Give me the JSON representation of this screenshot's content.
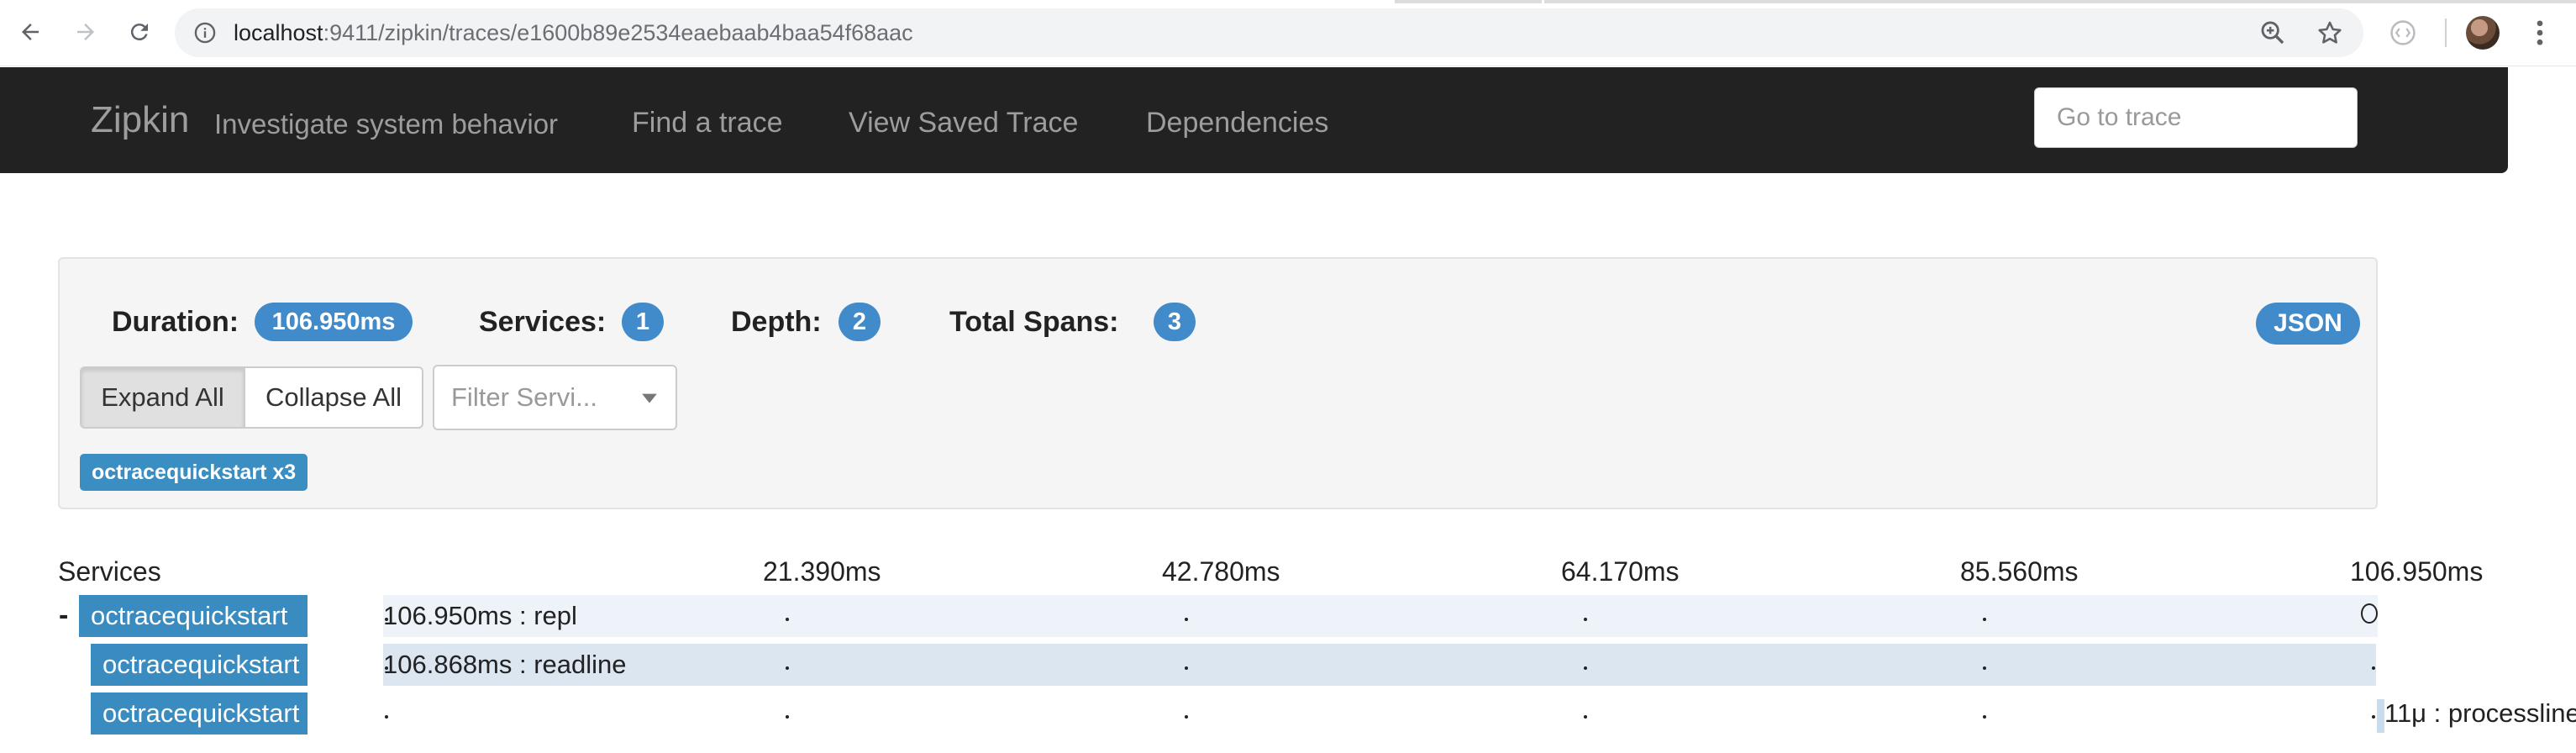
{
  "browser": {
    "url_host": "localhost",
    "url_path": ":9411/zipkin/traces/e1600b89e2534eaebaab4baa54f68aac"
  },
  "navbar": {
    "brand": "Zipkin",
    "tagline": "Investigate system behavior",
    "links": [
      "Find a trace",
      "View Saved Trace",
      "Dependencies"
    ],
    "goto_placeholder": "Go to trace"
  },
  "summary": {
    "duration_label": "Duration:",
    "duration_value": "106.950ms",
    "services_label": "Services:",
    "services_value": "1",
    "depth_label": "Depth:",
    "depth_value": "2",
    "total_spans_label": "Total Spans:",
    "total_spans_value": "3",
    "json_label": "JSON",
    "expand_all": "Expand All",
    "collapse_all": "Collapse All",
    "filter_placeholder": "Filter Servi...",
    "service_tag": "octracequickstart x3"
  },
  "timeline": {
    "services_header": "Services",
    "ticks": [
      "21.390ms",
      "42.780ms",
      "64.170ms",
      "85.560ms",
      "106.950ms"
    ],
    "expander": "-",
    "rows": [
      {
        "service": "octracequickstart",
        "label": "106.950ms : repl"
      },
      {
        "service": "octracequickstart",
        "label": "106.868ms : readline"
      },
      {
        "service": "octracequickstart",
        "label": "11μ : processline"
      }
    ]
  },
  "colors": {
    "navbar_bg": "#222222",
    "badge_blue": "#428bca",
    "service_blue": "#3a8bc0",
    "row1_bg": "#eef3f9",
    "row2_bg": "#dbe6f1"
  }
}
